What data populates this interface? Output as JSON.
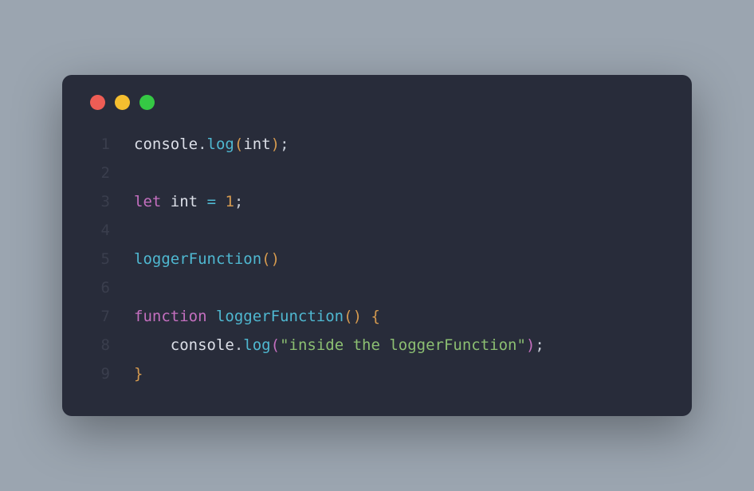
{
  "titlebar": {
    "close": "close",
    "minimize": "minimize",
    "maximize": "maximize"
  },
  "code": {
    "lines": [
      {
        "num": "1"
      },
      {
        "num": "2"
      },
      {
        "num": "3"
      },
      {
        "num": "4"
      },
      {
        "num": "5"
      },
      {
        "num": "6"
      },
      {
        "num": "7"
      },
      {
        "num": "8"
      },
      {
        "num": "9"
      }
    ],
    "tokens": {
      "l1_obj": "console",
      "l1_dot": ".",
      "l1_method": "log",
      "l1_lp": "(",
      "l1_arg": "int",
      "l1_rp": ")",
      "l1_semi": ";",
      "l3_let": "let",
      "l3_sp1": " ",
      "l3_name": "int",
      "l3_sp2": " ",
      "l3_eq": "=",
      "l3_sp3": " ",
      "l3_val": "1",
      "l3_semi": ";",
      "l5_fn": "loggerFunction",
      "l5_lp": "(",
      "l5_rp": ")",
      "l7_kw": "function",
      "l7_sp": " ",
      "l7_name": "loggerFunction",
      "l7_lp": "(",
      "l7_rp": ")",
      "l7_sp2": " ",
      "l7_brace": "{",
      "l8_indent": "    ",
      "l8_obj": "console",
      "l8_dot": ".",
      "l8_method": "log",
      "l8_lp": "(",
      "l8_str": "\"inside the loggerFunction\"",
      "l8_rp": ")",
      "l8_semi": ";",
      "l9_brace": "}"
    }
  }
}
